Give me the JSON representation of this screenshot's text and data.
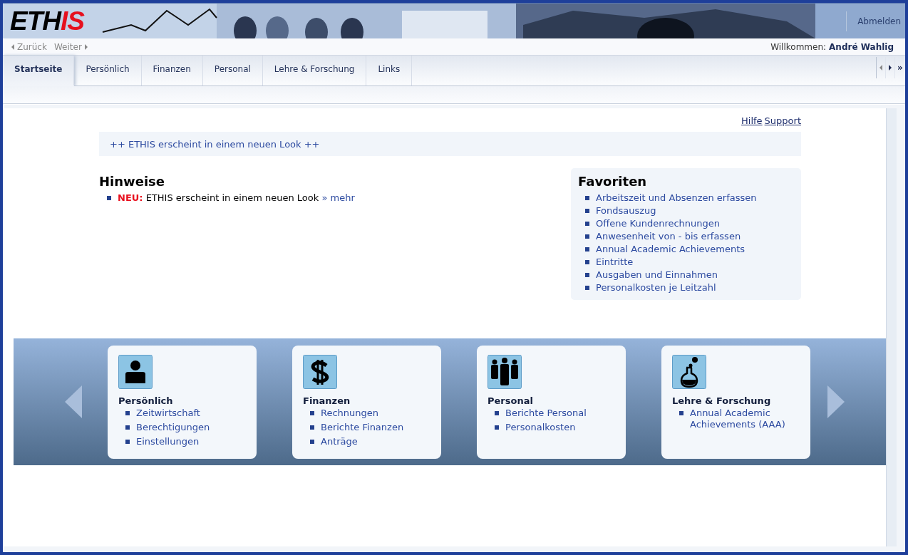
{
  "header": {
    "logo_black": "ETH",
    "logo_red": "IS",
    "logout": "Abmelden"
  },
  "nav": {
    "back": "Zurück",
    "forward": "Weiter",
    "welcome_label": "Willkommen:",
    "user": "André Wahlig"
  },
  "tabs": [
    {
      "label": "Startseite",
      "selected": true
    },
    {
      "label": "Persönlich",
      "selected": false
    },
    {
      "label": "Finanzen",
      "selected": false
    },
    {
      "label": "Personal",
      "selected": false
    },
    {
      "label": "Lehre & Forschung",
      "selected": false
    },
    {
      "label": "Links",
      "selected": false
    }
  ],
  "tab_scroll": {
    "last": "»"
  },
  "help_links": [
    "Hilfe",
    "Support"
  ],
  "announcement": "++ ETHIS erscheint in einem neuen Look ++",
  "notices": {
    "title": "Hinweise",
    "items": [
      {
        "badge": "NEU:",
        "text": "ETHIS erscheint in einem neuen Look",
        "link": "» mehr"
      }
    ]
  },
  "favorites": {
    "title": "Favoriten",
    "items": [
      "Arbeitszeit und Absenzen erfassen",
      "Fondsauszug",
      "Offene Kundenrechnungen",
      "Anwesenheit von - bis erfassen",
      "Annual Academic Achievements",
      "Eintritte",
      "Ausgaben und Einnahmen",
      "Personalkosten je Leitzahl"
    ]
  },
  "categories": [
    {
      "kind": "person",
      "title": "Persönlich",
      "links": [
        "Zeitwirtschaft",
        "Berechtigungen",
        "Einstellungen"
      ]
    },
    {
      "kind": "money",
      "title": "Finanzen",
      "links": [
        "Rechnungen",
        "Berichte Finanzen",
        "Anträge"
      ]
    },
    {
      "kind": "group",
      "title": "Personal",
      "links": [
        "Berichte Personal",
        "Personalkosten"
      ]
    },
    {
      "kind": "flask",
      "title": "Lehre & Forschung",
      "links": [
        "Annual Academic Achievements (AAA)"
      ]
    }
  ]
}
